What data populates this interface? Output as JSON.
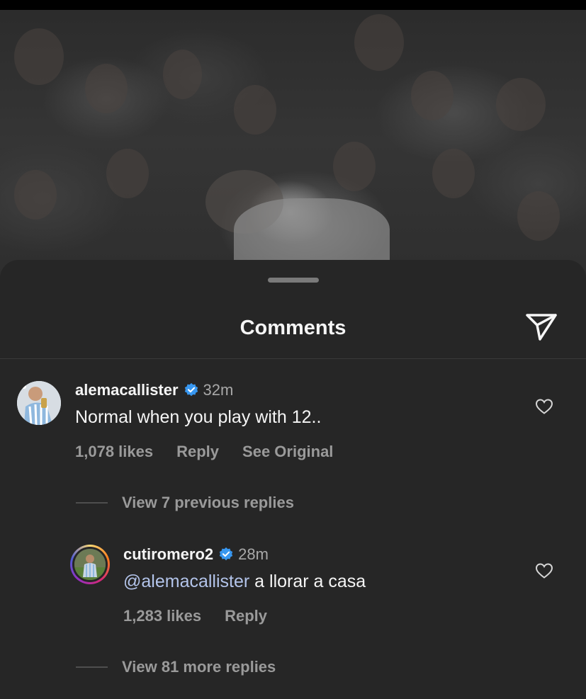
{
  "post_image": {
    "description_icon": "photo-background"
  },
  "sheet": {
    "title": "Comments",
    "share_icon": "send-icon"
  },
  "comments": [
    {
      "username": "alemacallister",
      "verified": true,
      "time": "32m",
      "text": "Normal when you play with 12..",
      "likes": "1,078 likes",
      "reply_label": "Reply",
      "see_original_label": "See Original"
    }
  ],
  "previous_replies_label": "View 7 previous replies",
  "replies": [
    {
      "username": "cutiromero2",
      "verified": true,
      "time": "28m",
      "mention": "@alemacallister",
      "text": " a llorar a casa",
      "likes": "1,283 likes",
      "reply_label": "Reply"
    }
  ],
  "more_replies_label": "View 81 more replies",
  "colors": {
    "background": "#262626",
    "verified": "#3897f0",
    "mention": "#b3c4ea",
    "secondary_text": "#a8a8a8"
  }
}
